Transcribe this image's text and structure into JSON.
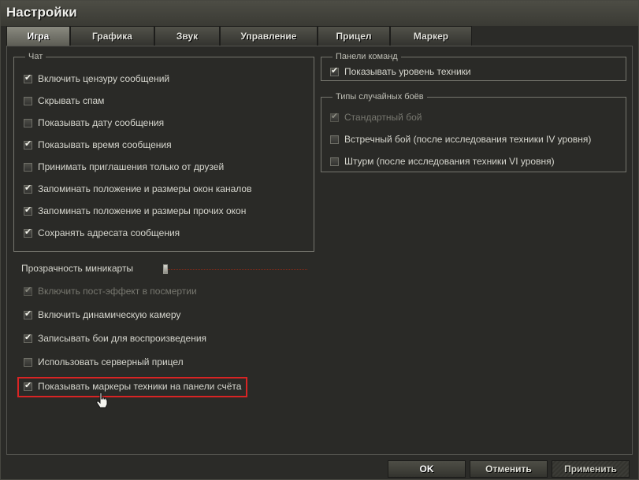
{
  "window": {
    "title": "Настройки"
  },
  "tabs": [
    {
      "label": "Игра",
      "active": true
    },
    {
      "label": "Графика",
      "active": false
    },
    {
      "label": "Звук",
      "active": false
    },
    {
      "label": "Управление",
      "active": false
    },
    {
      "label": "Прицел",
      "active": false
    },
    {
      "label": "Маркер",
      "active": false
    }
  ],
  "chat": {
    "legend": "Чат",
    "items": [
      {
        "label": "Включить цензуру сообщений",
        "checked": true
      },
      {
        "label": "Скрывать спам",
        "checked": false
      },
      {
        "label": "Показывать дату сообщения",
        "checked": false
      },
      {
        "label": "Показывать время сообщения",
        "checked": true
      },
      {
        "label": "Принимать приглашения только от друзей",
        "checked": false
      },
      {
        "label": "Запоминать положение и размеры окон каналов",
        "checked": true
      },
      {
        "label": "Запоминать положение и размеры прочих окон",
        "checked": true
      },
      {
        "label": "Сохранять адресата сообщения",
        "checked": true
      }
    ]
  },
  "command_panels": {
    "legend": "Панели команд",
    "items": [
      {
        "label": "Показывать уровень техники",
        "checked": true
      }
    ]
  },
  "battle_types": {
    "legend": "Типы случайных боёв",
    "items": [
      {
        "label": "Стандартный бой",
        "checked": true,
        "disabled": true
      },
      {
        "label": "Встречный бой (после исследования техники IV уровня)",
        "checked": false
      },
      {
        "label": "Штурм (после исследования техники VI уровня)",
        "checked": false
      }
    ]
  },
  "minimap": {
    "label": "Прозрачность миникарты",
    "value": 0
  },
  "general": {
    "items": [
      {
        "label": "Включить пост-эффект в посмертии",
        "checked": true,
        "disabled": true
      },
      {
        "label": "Включить динамическую камеру",
        "checked": true
      },
      {
        "label": "Записывать бои для воспроизведения",
        "checked": true
      },
      {
        "label": "Использовать серверный прицел",
        "checked": false
      },
      {
        "label": "Показывать маркеры техники на панели счёта",
        "checked": true,
        "highlighted": true
      }
    ]
  },
  "footer": {
    "ok": "OK",
    "cancel": "Отменить",
    "apply": "Применить"
  },
  "colors": {
    "highlight": "#d82424",
    "active_tab": "#8a8a80",
    "background": "#2a2a27"
  },
  "icons": {
    "check": "checkmark-icon",
    "cursor": "hand-pointer-icon"
  }
}
